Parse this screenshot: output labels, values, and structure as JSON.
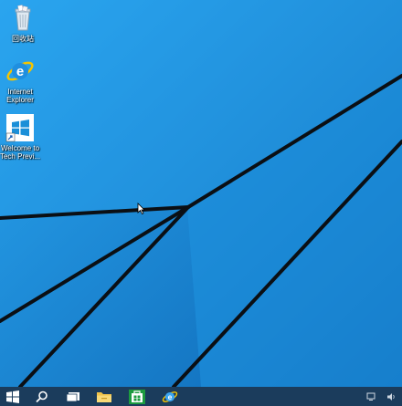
{
  "desktop": {
    "icons": [
      {
        "name": "recycle-bin",
        "label": "回收站",
        "icon": "recycle-bin-icon"
      },
      {
        "name": "internet-explorer",
        "label": "Internet Explorer",
        "icon": "ie-icon"
      },
      {
        "name": "welcome",
        "label": "Welcome to Tech Previ...",
        "icon": "windows-logo-icon"
      }
    ]
  },
  "taskbar": {
    "buttons": [
      {
        "name": "start-button",
        "icon": "windows-logo-icon"
      },
      {
        "name": "search-button",
        "icon": "search-icon"
      },
      {
        "name": "task-view-button",
        "icon": "task-view-icon"
      },
      {
        "name": "file-explorer-button",
        "icon": "folder-icon"
      },
      {
        "name": "store-button",
        "icon": "store-icon"
      },
      {
        "name": "ie-taskbar-button",
        "icon": "ie-icon"
      }
    ]
  },
  "colors": {
    "wallpaper": "#1a8fd8",
    "taskbar": "#1b3c5c",
    "accent": "#ffffff"
  }
}
